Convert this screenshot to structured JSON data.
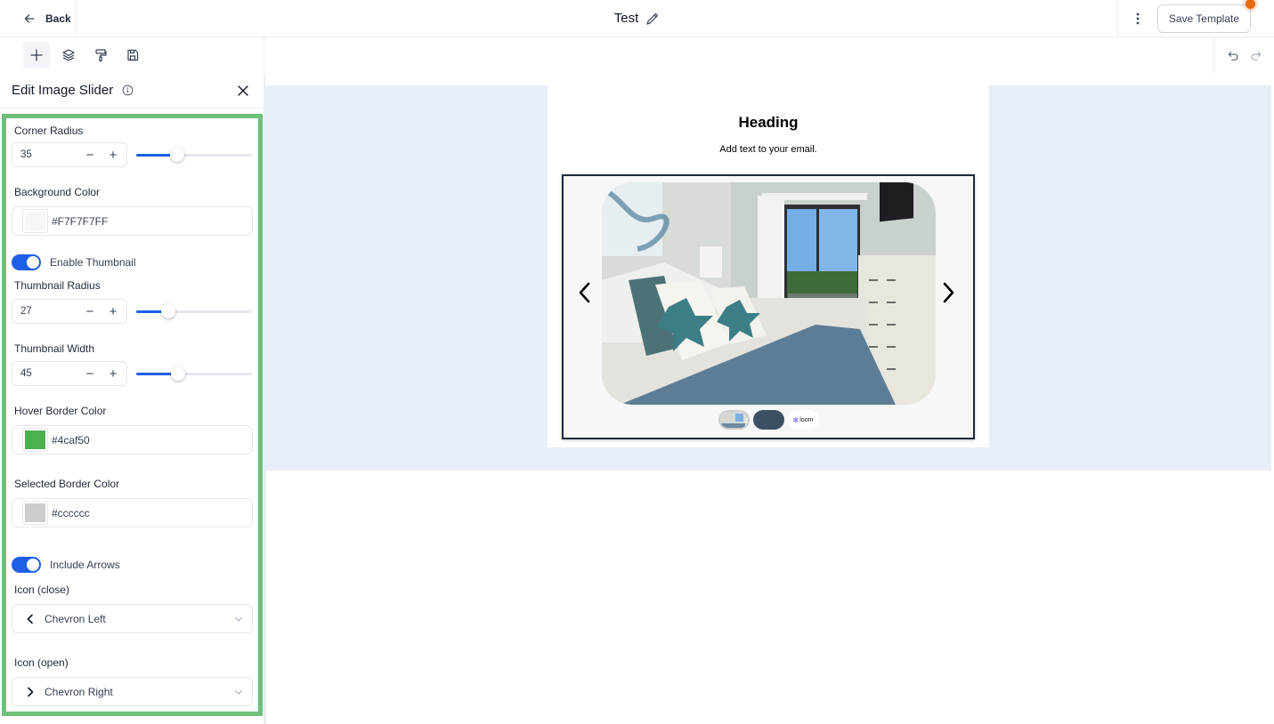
{
  "topbar": {
    "back_label": "Back",
    "title": "Test",
    "save_label": "Save Template",
    "icons": {
      "back": "arrow-left-icon",
      "edit": "pencil-icon",
      "more": "kebab-vertical-icon"
    },
    "notification_dot_color": "#e8680f"
  },
  "toolbar": {
    "items": [
      {
        "name": "add",
        "icon": "plus-icon",
        "active": true
      },
      {
        "name": "layers",
        "icon": "layers-icon",
        "active": false
      },
      {
        "name": "styles",
        "icon": "paint-roller-icon",
        "active": false
      },
      {
        "name": "save",
        "icon": "floppy-disk-icon",
        "active": false
      }
    ]
  },
  "panel": {
    "title": "Edit Image Slider",
    "fields": {
      "corner_radius": {
        "label": "Corner Radius",
        "value": "35",
        "fraction": 0.35
      },
      "background_color": {
        "label": "Background Color",
        "value": "#F7F7F7FF",
        "swatch": "#F7F7F7"
      },
      "enable_thumbnail": {
        "label": "Enable Thumbnail",
        "on": true
      },
      "thumbnail_radius": {
        "label": "Thumbnail Radius",
        "value": "27",
        "fraction": 0.28
      },
      "thumbnail_width": {
        "label": "Thumbnail Width",
        "value": "45",
        "fraction": 0.36
      },
      "hover_border_color": {
        "label": "Hover Border Color",
        "value": "#4caf50",
        "swatch": "#4caf50"
      },
      "selected_border_color": {
        "label": "Selected Border Color",
        "value": "#cccccc",
        "swatch": "#cccccc"
      },
      "include_arrows": {
        "label": "Include Arrows",
        "on": true
      },
      "icon_close": {
        "label": "Icon (close)",
        "value": "Chevron Left"
      },
      "icon_open": {
        "label": "Icon (open)",
        "value": "Chevron Right"
      }
    },
    "highlight_color": "#6dbf7a",
    "accent_color": "#1e5ee6"
  },
  "canvas": {
    "heading": "Heading",
    "body_text": "Add text to your email.",
    "thumbnail_logo_text": "loom",
    "main_image_alt": "bedroom with starfish pillows and balcony view"
  }
}
